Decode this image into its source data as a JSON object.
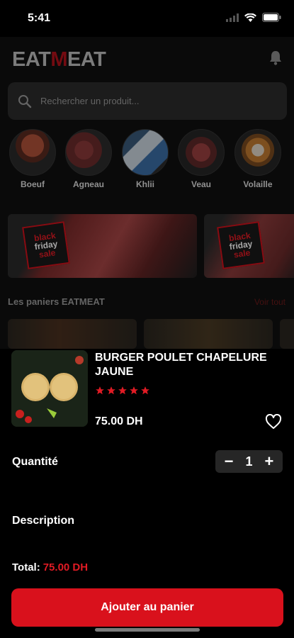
{
  "status": {
    "time": "5:41"
  },
  "header": {
    "logo_prefix": "EAT",
    "logo_mid": "M",
    "logo_suffix": "EAT",
    "bell_icon": "bell-icon"
  },
  "search": {
    "placeholder": "Rechercher un produit..."
  },
  "categories": [
    {
      "label": "Boeuf"
    },
    {
      "label": "Agneau"
    },
    {
      "label": "Khlii"
    },
    {
      "label": "Veau"
    },
    {
      "label": "Volaille"
    }
  ],
  "banners": {
    "tag_line1": "black",
    "tag_line2": "friday",
    "tag_line3": "sale"
  },
  "section": {
    "title": "Les paniers EATMEAT",
    "see_all": "Voir tout"
  },
  "product": {
    "name": "BURGER POULET CHAPELURE JAUNE",
    "rating": 5,
    "price": "75.00 DH"
  },
  "quantity": {
    "label": "Quantité",
    "minus": "−",
    "value": "1",
    "plus": "+"
  },
  "description": {
    "label": "Description"
  },
  "total": {
    "label": "Total:",
    "amount": "75.00 DH"
  },
  "cta": {
    "label": "Ajouter au panier"
  },
  "colors": {
    "accent": "#d9111c",
    "background": "#000000",
    "card": "#262626"
  }
}
